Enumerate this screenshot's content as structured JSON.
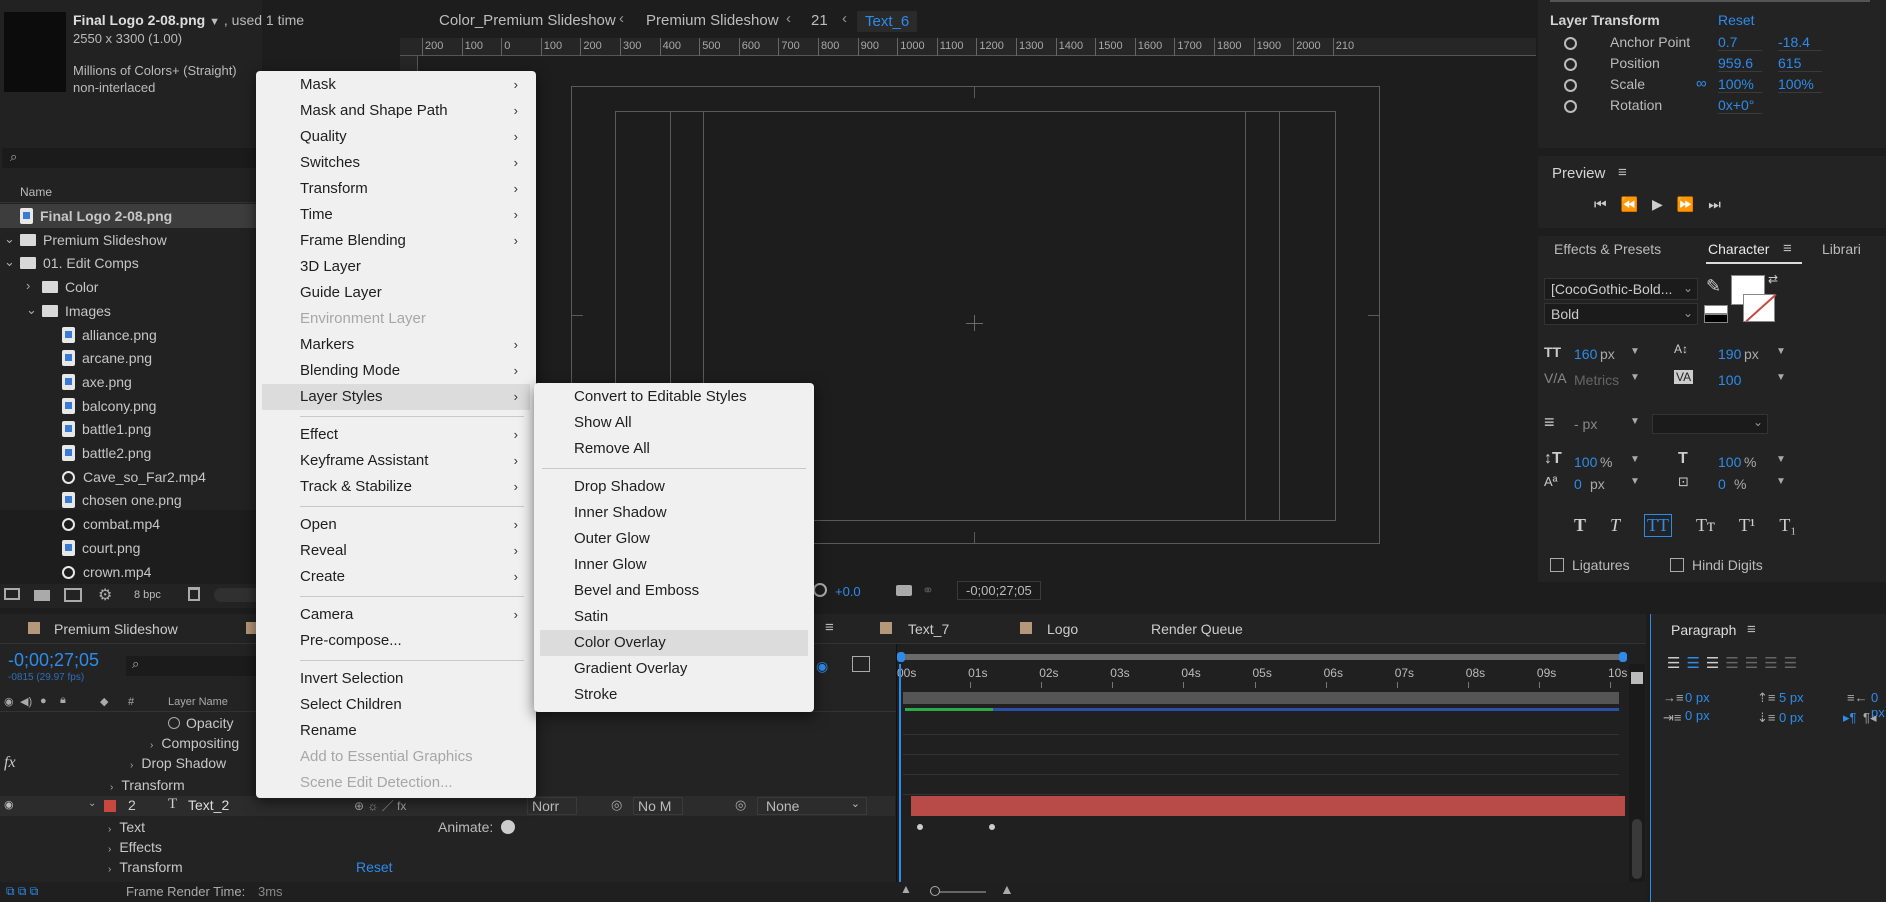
{
  "project": {
    "preview_name": "Final Logo 2-08.png",
    "used": ", used 1 time",
    "dims": "2550 x 3300 (1.00)",
    "colors": "Millions of Colors+ (Straight)",
    "interlace": "non-interlaced",
    "col_name": "Name",
    "items": [
      {
        "label": "Final Logo 2-08.png",
        "type": "file",
        "indent": 0
      },
      {
        "label": "Premium Slideshow",
        "type": "folder",
        "indent": 0
      },
      {
        "label": "01. Edit Comps",
        "type": "folder",
        "indent": 1
      },
      {
        "label": "Color",
        "type": "folder",
        "indent": 2
      },
      {
        "label": "Images",
        "type": "folder",
        "indent": 2
      },
      {
        "label": "alliance.png",
        "type": "file",
        "indent": 3
      },
      {
        "label": "arcane.png",
        "type": "file",
        "indent": 3
      },
      {
        "label": "axe.png",
        "type": "file",
        "indent": 3
      },
      {
        "label": "balcony.png",
        "type": "file",
        "indent": 3
      },
      {
        "label": "battle1.png",
        "type": "file",
        "indent": 3
      },
      {
        "label": "battle2.png",
        "type": "file",
        "indent": 3
      },
      {
        "label": "Cave_so_Far2.mp4",
        "type": "video",
        "indent": 3
      },
      {
        "label": "chosen one.png",
        "type": "file",
        "indent": 3
      },
      {
        "label": "combat.mp4",
        "type": "video",
        "indent": 3
      },
      {
        "label": "court.png",
        "type": "file",
        "indent": 3
      },
      {
        "label": "crown.mp4",
        "type": "video",
        "indent": 3
      }
    ],
    "bpc": "8 bpc"
  },
  "viewer": {
    "crumbs": [
      "Color_Premium Slideshow",
      "Premium Slideshow",
      "21",
      "Text_6"
    ],
    "ruler": [
      "200",
      "100",
      "0",
      "100",
      "200",
      "300",
      "400",
      "500",
      "600",
      "700",
      "800",
      "900",
      "1000",
      "1100",
      "1200",
      "1300",
      "1400",
      "1500",
      "1600",
      "1700",
      "1800",
      "1900",
      "2000",
      "210"
    ],
    "exposure": "+0.0",
    "timecode": "-0;00;27;05"
  },
  "context_menu": {
    "items": [
      {
        "label": "Mask",
        "sub": true
      },
      {
        "label": "Mask and Shape Path",
        "sub": true
      },
      {
        "label": "Quality",
        "sub": true
      },
      {
        "label": "Switches",
        "sub": true
      },
      {
        "label": "Transform",
        "sub": true
      },
      {
        "label": "Time",
        "sub": true
      },
      {
        "label": "Frame Blending",
        "sub": true
      },
      {
        "label": "3D Layer",
        "sub": false
      },
      {
        "label": "Guide Layer",
        "sub": false
      },
      {
        "label": "Environment Layer",
        "sub": false,
        "disabled": true
      },
      {
        "label": "Markers",
        "sub": true
      },
      {
        "label": "Blending Mode",
        "sub": true
      },
      {
        "label": "Layer Styles",
        "sub": true,
        "hl": true
      },
      {
        "sep": true
      },
      {
        "label": "Effect",
        "sub": true
      },
      {
        "label": "Keyframe Assistant",
        "sub": true
      },
      {
        "label": "Track & Stabilize",
        "sub": true
      },
      {
        "sep": true
      },
      {
        "label": "Open",
        "sub": true
      },
      {
        "label": "Reveal",
        "sub": true
      },
      {
        "label": "Create",
        "sub": true
      },
      {
        "sep": true
      },
      {
        "label": "Camera",
        "sub": true
      },
      {
        "label": "Pre-compose...",
        "sub": false
      },
      {
        "sep": true
      },
      {
        "label": "Invert Selection",
        "sub": false
      },
      {
        "label": "Select Children",
        "sub": false
      },
      {
        "label": "Rename",
        "sub": false
      },
      {
        "label": "Add to Essential Graphics",
        "sub": false,
        "disabled": true
      },
      {
        "label": "Scene Edit Detection...",
        "sub": false,
        "disabled": true
      }
    ]
  },
  "submenu": {
    "items": [
      {
        "label": "Convert to Editable Styles"
      },
      {
        "label": "Show All"
      },
      {
        "label": "Remove All"
      },
      {
        "sep": true
      },
      {
        "label": "Drop Shadow"
      },
      {
        "label": "Inner Shadow"
      },
      {
        "label": "Outer Glow"
      },
      {
        "label": "Inner Glow"
      },
      {
        "label": "Bevel and Emboss"
      },
      {
        "label": "Satin"
      },
      {
        "label": "Color Overlay",
        "hl": true
      },
      {
        "label": "Gradient Overlay"
      },
      {
        "label": "Stroke"
      }
    ]
  },
  "layer_transform": {
    "title": "Layer Transform",
    "reset": "Reset",
    "rows": [
      {
        "label": "Anchor Point",
        "v1": "0.7",
        "v2": "-18.4"
      },
      {
        "label": "Position",
        "v1": "959.6",
        "v2": "615"
      },
      {
        "label": "Scale",
        "v1": "100%",
        "v2": "100%"
      },
      {
        "label": "Rotation",
        "v1": "0x+0°",
        "v2": ""
      }
    ]
  },
  "preview": {
    "title": "Preview"
  },
  "character": {
    "tabs": [
      "Effects & Presets",
      "Character",
      "Librari"
    ],
    "font": "[CocoGothic-Bold...",
    "style": "Bold",
    "size": "160",
    "size_unit": "px",
    "leading": "190",
    "leading_unit": "px",
    "kerning": "Metrics",
    "tracking": "100",
    "stroke": "- px",
    "vscale": "100",
    "vscale_unit": "%",
    "hscale": "100",
    "hscale_unit": "%",
    "baseline": "0",
    "baseline_unit": "px",
    "tsume": "0",
    "tsume_unit": "%",
    "ligatures": "Ligatures",
    "hindi": "Hindi Digits"
  },
  "paragraph": {
    "title": "Paragraph",
    "v1": "0 px",
    "v2": "5 px",
    "v3": "0 px",
    "v4": "0 px",
    "v5": "0 px"
  },
  "timeline": {
    "tabs": [
      "Premium Slideshow",
      "Text_7",
      "Logo",
      "Render Queue"
    ],
    "timecode": "-0;00;27;05",
    "fps": "-0815 (29.97 fps)",
    "col_hash": "#",
    "col_layer": "Layer Name",
    "time_labels": [
      "00s",
      "01s",
      "02s",
      "03s",
      "04s",
      "05s",
      "06s",
      "07s",
      "08s",
      "09s",
      "10s"
    ],
    "rows": {
      "opacity": "Opacity",
      "compositing": "Compositing",
      "drop_shadow": "Drop Shadow",
      "transform1": "Transform",
      "layer_num": "2",
      "layer_name": "Text_2",
      "mode": "Norr",
      "trkmat": "No M",
      "parent": "None",
      "text": "Text",
      "animate": "Animate:",
      "effects": "Effects",
      "transform2": "Transform",
      "reset": "Reset"
    },
    "frame_render_label": "Frame Render Time:",
    "frame_render_val": "3ms"
  },
  "colors": {
    "accent": "#2d8ceb",
    "label_red": "#c8473f",
    "clip_red": "#b84a47",
    "label_tan": "#b5977a"
  }
}
